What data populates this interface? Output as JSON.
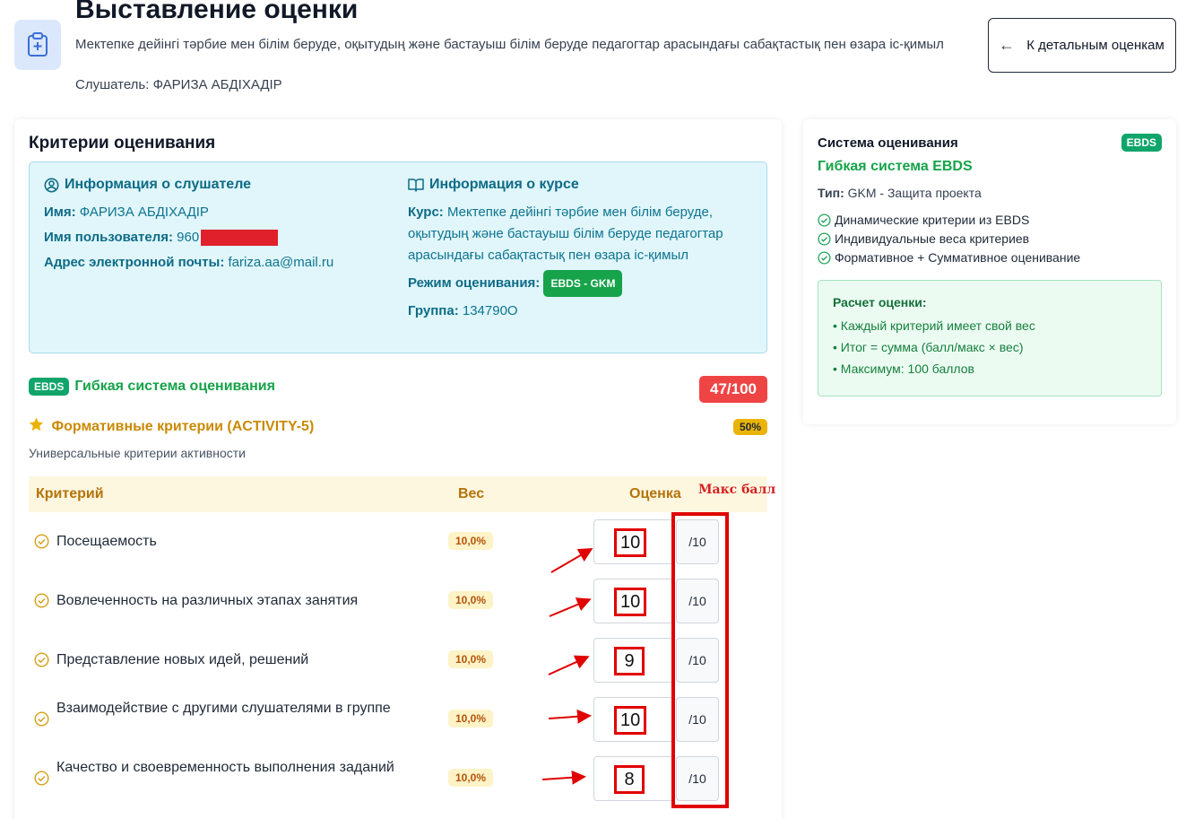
{
  "header": {
    "title": "Выставление оценки",
    "subtitle": "Мектепке дейінгі тәрбие мен білім беруде, оқытудың және бастауыш білім беруде педагогтар арасындағы сабақтастық пен өзара іс-қимыл",
    "listener": "Слушатель: ФАРИЗА АБДІХАДІР",
    "back_label": "К детальным оценкам"
  },
  "criteria_card": {
    "title": "Критерии оценивания",
    "student": {
      "heading": "Информация о слушателе",
      "name_label": "Имя:",
      "name_value": "ФАРИЗА АБДІХАДІР",
      "username_label": "Имя пользователя:",
      "username_value": "960",
      "email_label": "Адрес электронной почты:",
      "email_value": "fariza.aa@mail.ru"
    },
    "course": {
      "heading": "Информация о курсе",
      "course_label": "Курс:",
      "course_value": "Мектепке дейінгі тәрбие мен білім беруде, оқытудың және бастауыш білім беруде педагогтар арасындағы сабақтастық пен өзара іс-қимыл",
      "mode_label": "Режим оценивания:",
      "mode_value": "EBDS - GKM",
      "group_label": "Группа:",
      "group_value": "134790О"
    },
    "ebds_badge": "EBDS",
    "system_title": "Гибкая система оценивания",
    "total_score": "47/100",
    "formative_title": "Формативные критерии (ACTIVITY-5)",
    "formative_pct": "50%",
    "formative_sub": "Универсальные критерии активности",
    "columns": {
      "criterion": "Критерий",
      "weight": "Вес",
      "score": "Оценка"
    },
    "max_label": "Макс балл",
    "rows": [
      {
        "criterion": "Посещаемость",
        "weight": "10,0%",
        "score": "10",
        "max": "/10"
      },
      {
        "criterion": "Вовлеченность на различных этапах занятия",
        "weight": "10,0%",
        "score": "10",
        "max": "/10"
      },
      {
        "criterion": "Представление новых идей, решений",
        "weight": "10,0%",
        "score": "9",
        "max": "/10"
      },
      {
        "criterion": "Взаимодействие с другими слушателями в группе",
        "weight": "10,0%",
        "score": "10",
        "max": "/10"
      },
      {
        "criterion": "Качество и своевременность выполнения заданий",
        "weight": "10,0%",
        "score": "8",
        "max": "/10"
      }
    ]
  },
  "system_card": {
    "title": "Система оценивания",
    "badge": "EBDS",
    "system_name": "Гибкая система EBDS",
    "type_label": "Тип:",
    "type_value": "GKM - Защита проекта",
    "features": [
      "Динамические критерии из EBDS",
      "Индивидуальные веса критериев",
      "Формативное + Суммативное оценивание"
    ],
    "calc_title": "Расчет оценки:",
    "calc_items": [
      "• Каждый критерий имеет свой вес",
      "• Итог = сумма (балл/макс × вес)",
      "• Максимум: 100 баллов"
    ]
  },
  "colors": {
    "accent_green": "#16a34a",
    "accent_teal": "#0e7490",
    "accent_amber": "#ca8a04",
    "danger": "#ef4444"
  }
}
